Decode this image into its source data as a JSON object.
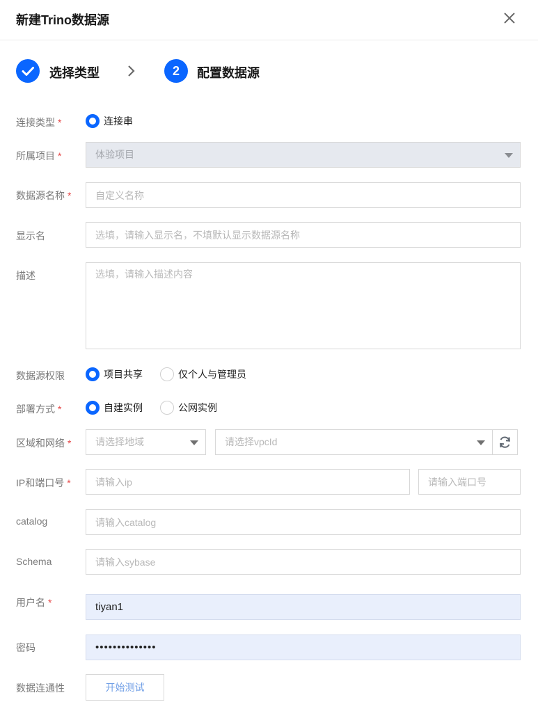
{
  "dialog": {
    "title": "新建Trino数据源"
  },
  "steps": [
    {
      "number": "1",
      "label": "选择类型",
      "state": "done"
    },
    {
      "number": "2",
      "label": "配置数据源",
      "state": "active"
    }
  ],
  "form": {
    "conn_type": {
      "label": "连接类型",
      "option": "连接串"
    },
    "project": {
      "label": "所属项目",
      "value": "体验项目"
    },
    "name": {
      "label": "数据源名称",
      "placeholder": "自定义名称"
    },
    "display_name": {
      "label": "显示名",
      "placeholder": "选填，请输入显示名，不填默认显示数据源名称"
    },
    "description": {
      "label": "描述",
      "placeholder": "选填，请输入描述内容"
    },
    "permission": {
      "label": "数据源权限",
      "options": [
        "项目共享",
        "仅个人与管理员"
      ],
      "selected": "项目共享"
    },
    "deploy": {
      "label": "部署方式",
      "options": [
        "自建实例",
        "公网实例"
      ],
      "selected": "自建实例"
    },
    "region": {
      "label": "区域和网络",
      "region_placeholder": "请选择地域",
      "vpc_placeholder": "请选择vpcId"
    },
    "ip_port": {
      "label": "IP和端口号",
      "ip_placeholder": "请输入ip",
      "port_placeholder": "请输入端口号"
    },
    "catalog": {
      "label": "catalog",
      "placeholder": "请输入catalog"
    },
    "schema": {
      "label": "Schema",
      "placeholder": "请输入sybase"
    },
    "username": {
      "label": "用户名",
      "value": "tiyan1"
    },
    "password": {
      "label": "密码",
      "value": "••••••••••••••"
    },
    "connectivity": {
      "label": "数据连通性",
      "button": "开始测试"
    }
  },
  "required_mark": "*",
  "colors": {
    "primary": "#0a66ff",
    "required": "#e54545"
  },
  "icons": {
    "close": "close-icon",
    "done": "check-icon",
    "arrow": "chevron-right-icon",
    "refresh": "refresh-icon"
  }
}
